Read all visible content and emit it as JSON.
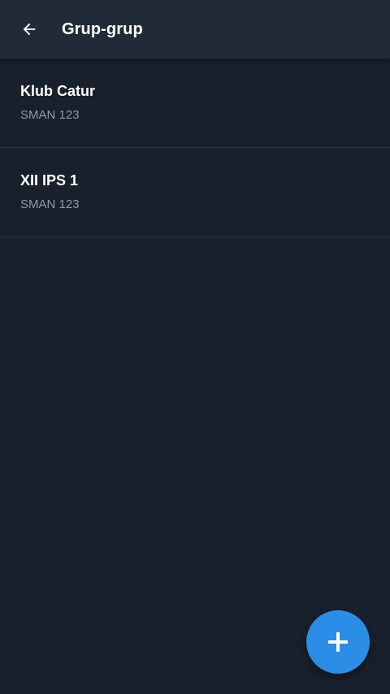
{
  "app_bar": {
    "title": "Grup-grup",
    "back_icon": "arrow-left-icon"
  },
  "groups": [
    {
      "name": "Klub Catur",
      "school": "SMAN 123"
    },
    {
      "name": "XII IPS 1",
      "school": "SMAN 123"
    }
  ],
  "fab": {
    "icon": "plus-icon",
    "color": "#2a8ee6"
  },
  "colors": {
    "background": "#18202c",
    "app_bar": "#212b38",
    "divider": "#2b3644",
    "secondary_text": "#8f9aa8"
  }
}
